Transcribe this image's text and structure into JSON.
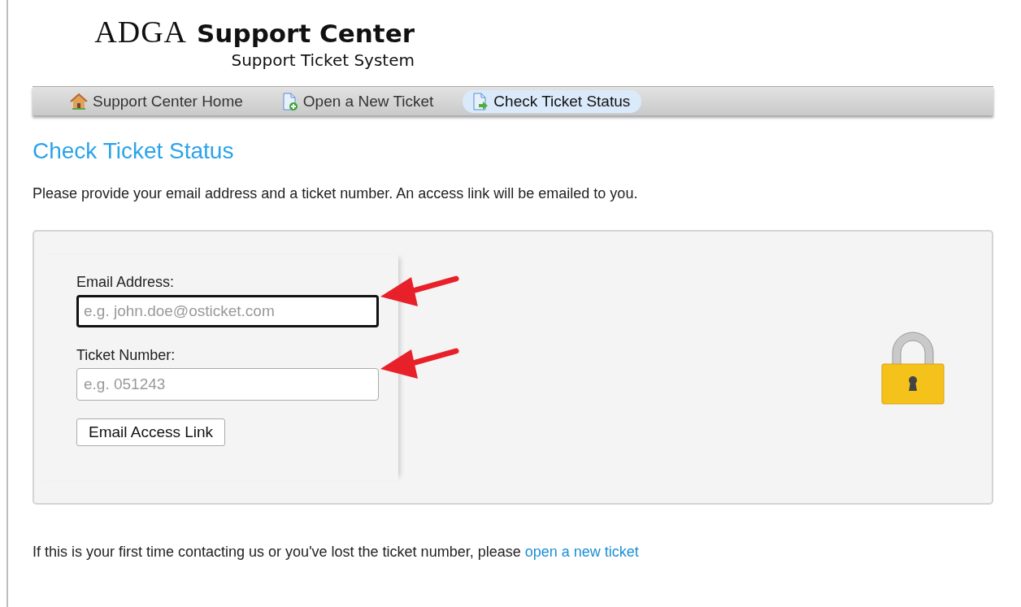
{
  "header": {
    "logo_mark": "ADGA",
    "logo_title": "Support Center",
    "logo_subtitle": "Support Ticket System"
  },
  "nav": [
    {
      "label": "Support Center Home",
      "kind": "home",
      "selected": false
    },
    {
      "label": "Open a New Ticket",
      "kind": "new",
      "selected": false
    },
    {
      "label": "Check Ticket Status",
      "kind": "status",
      "selected": true
    }
  ],
  "heading": "Check Ticket Status",
  "intro": "Please provide your email address and a ticket number. An access link will be emailed to you.",
  "form": {
    "fields": [
      {
        "label": "Email Address:",
        "placeholder": "e.g. john.doe@osticket.com",
        "focused": true
      },
      {
        "label": "Ticket Number:",
        "placeholder": "e.g. 051243",
        "focused": false
      }
    ],
    "button": "Email Access Link"
  },
  "footer": {
    "text": "If this is your first time contacting us or you've lost the ticket number, please",
    "link": "open a new ticket"
  }
}
